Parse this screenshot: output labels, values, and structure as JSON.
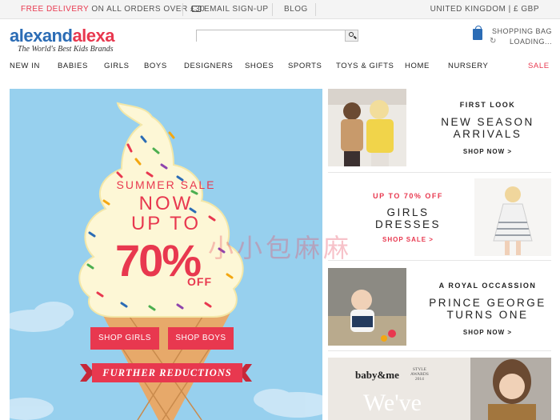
{
  "topbar": {
    "delivery_highlight": "FREE DELIVERY",
    "delivery_rest": " ON ALL ORDERS OVER £30",
    "email_signup": "EMAIL SIGN-UP",
    "blog": "BLOG",
    "region": "UNITED KINGDOM | £ GBP"
  },
  "header": {
    "logo_part1": "alexand",
    "logo_part2": "alexa",
    "tagline": "The World's Best Kids Brands",
    "search_placeholder": "",
    "bag_label": "SHOPPING BAG",
    "bag_status": "LOADING..."
  },
  "nav": {
    "items": [
      "NEW IN",
      "BABIES",
      "GIRLS",
      "BOYS",
      "DESIGNERS",
      "SHOES",
      "SPORTS",
      "TOYS & GIFTS",
      "HOME",
      "NURSERY",
      "SALE"
    ]
  },
  "hero": {
    "summer_sale": "SUMMER SALE",
    "now": "NOW",
    "up_to": "UP TO",
    "percent": "70%",
    "off": "OFF",
    "shop_girls": "SHOP GIRLS",
    "shop_boys": "SHOP BOYS",
    "further": "FURTHER REDUCTIONS",
    "colors": {
      "sky": "#97d0ee",
      "accent": "#e8384f",
      "cream": "#fdf7d6",
      "cone": "#e7a96a"
    }
  },
  "promos": [
    {
      "kicker": "FIRST LOOK",
      "title1": "NEW SEASON",
      "title2": "ARRIVALS",
      "cta": "SHOP NOW >"
    },
    {
      "kicker": "UP TO 70% OFF",
      "title1": "GIRLS",
      "title2": "DRESSES",
      "cta": "SHOP SALE >"
    },
    {
      "kicker": "A ROYAL OCCASSION",
      "title1": "PRINCE GEORGE",
      "title2": "TURNS ONE",
      "cta": "SHOP NOW >"
    },
    {
      "brand": "baby&me",
      "awards1": "STYLE",
      "awards2": "AWARDS",
      "awards3": "2014",
      "headline": "We've"
    }
  ],
  "watermark": "小小包麻麻"
}
